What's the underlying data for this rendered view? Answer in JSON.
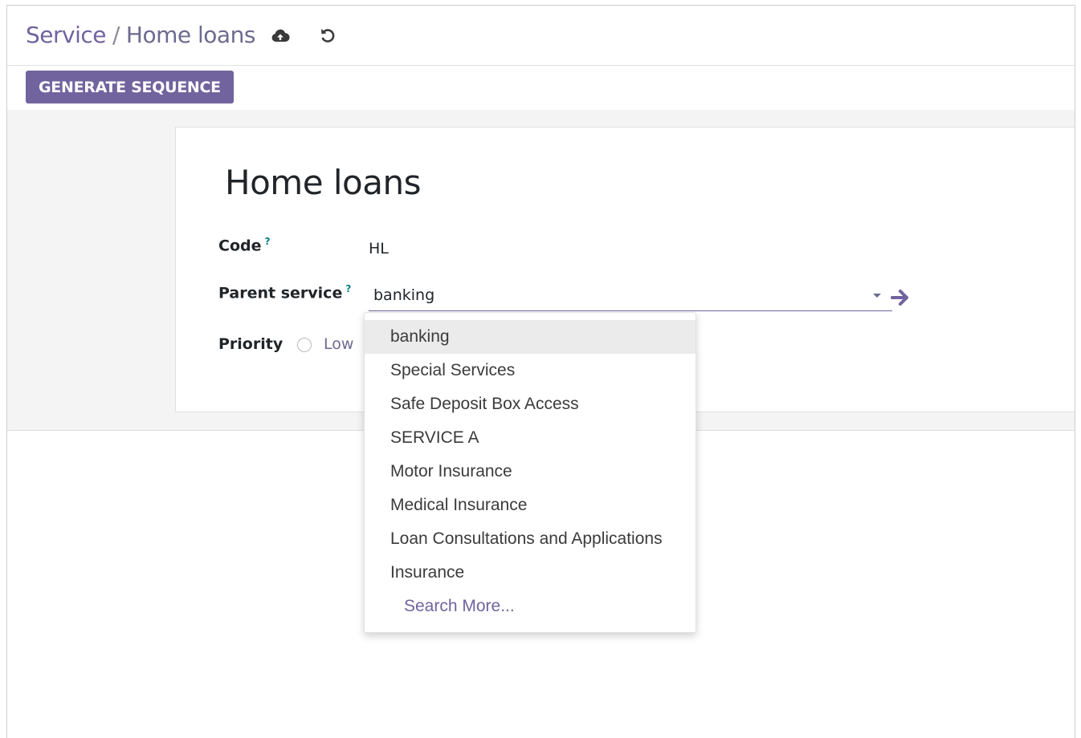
{
  "breadcrumb": {
    "parent": "Service",
    "separator": "/",
    "current": "Home loans"
  },
  "toolbar": {
    "save_icon": "cloud-upload-icon",
    "discard_icon": "undo-icon",
    "generate_sequence_label": "GENERATE SEQUENCE"
  },
  "form": {
    "title": "Home loans",
    "code": {
      "label": "Code",
      "help": "?",
      "value": "HL"
    },
    "parent_service": {
      "label": "Parent service",
      "help": "?",
      "value": "banking"
    },
    "priority": {
      "label": "Priority",
      "option": "Low"
    }
  },
  "dropdown": {
    "items": [
      "banking",
      "Special Services",
      "Safe Deposit Box Access",
      "SERVICE A",
      "Motor Insurance",
      "Medical Insurance",
      "Loan Consultations and Applications",
      "Insurance"
    ],
    "active_index": 0,
    "search_more": "Search More..."
  },
  "colors": {
    "brand": "#71639e",
    "help": "#017e84",
    "form_background": "#f4f4f4"
  }
}
